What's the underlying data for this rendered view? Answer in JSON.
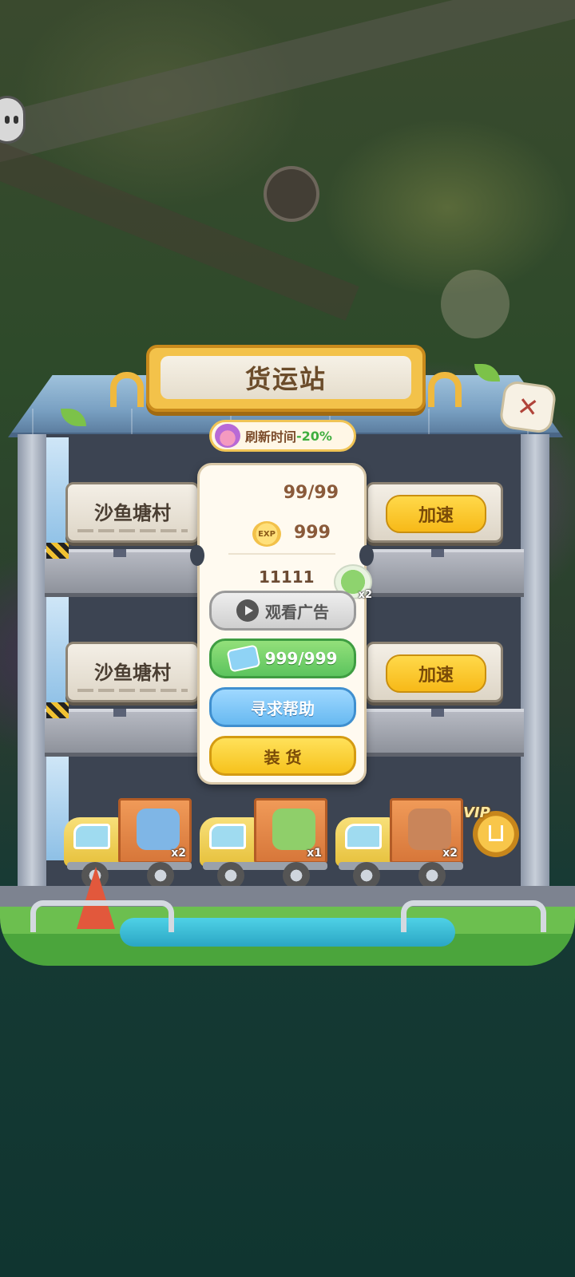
{
  "title": "货运站",
  "refresh": {
    "label": "刷新时间",
    "bonus": "-20%"
  },
  "close_icon": "close-icon",
  "docks": [
    {
      "location": "沙鱼塘村",
      "action": "加速"
    },
    {
      "location": "沙鱼塘村",
      "action": "加速"
    }
  ],
  "popup": {
    "count": "99/99",
    "exp_icon_text": "EXP",
    "exp": "999",
    "coins": "11111",
    "ticket_multiplier": "x2",
    "buttons": {
      "watch_ad": "观看广告",
      "ticket": "999/999",
      "help": "寻求帮助",
      "load": "装 货"
    }
  },
  "trucks": [
    {
      "item": "shirt-icon",
      "qty": "x2",
      "color": "#7fb6e6"
    },
    {
      "item": "rice-bundle-icon",
      "qty": "x1",
      "color": "#8fcf6a"
    },
    {
      "item": "crate-icon",
      "qty": "x2",
      "color": "#c9855a"
    }
  ],
  "vip": {
    "label": "VIP"
  },
  "colors": {
    "accent_yellow": "#f6c21c",
    "help_blue": "#67b9f1",
    "ticket_green": "#5cc45e"
  }
}
